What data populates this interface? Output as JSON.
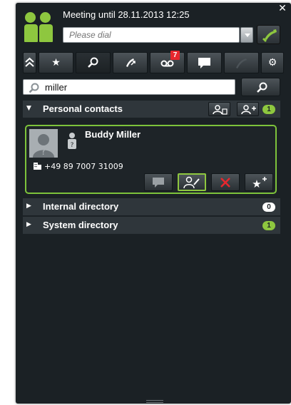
{
  "header": {
    "status_text": "Meeting until 28.11.2013 12:25",
    "dial_placeholder": "Please dial"
  },
  "toolbar": {
    "buttons": [
      {
        "name": "collapse",
        "icon": "double-chevron-up-icon"
      },
      {
        "name": "favorites",
        "icon": "star-icon"
      },
      {
        "name": "search",
        "icon": "search-icon"
      },
      {
        "name": "call-journal",
        "icon": "call-journal-icon"
      },
      {
        "name": "voicemail",
        "icon": "voicemail-icon",
        "badge": "7"
      },
      {
        "name": "chat",
        "icon": "chat-bubble-icon"
      },
      {
        "name": "phone",
        "icon": "phone-handset-icon"
      },
      {
        "name": "settings",
        "icon": "gear-icon"
      }
    ]
  },
  "search": {
    "value": "miller"
  },
  "sections": {
    "personal": {
      "title": "Personal contacts",
      "count": "1"
    },
    "internal": {
      "title": "Internal directory",
      "count": "0"
    },
    "system": {
      "title": "System directory",
      "count": "1"
    }
  },
  "contact": {
    "name": "Buddy Miller",
    "phone": "+49 89 7007 31009"
  },
  "colors": {
    "accent_green": "#8ec73f",
    "badge_red": "#e8272e",
    "background": "#1b2125",
    "section_bar": "#2f363b"
  }
}
